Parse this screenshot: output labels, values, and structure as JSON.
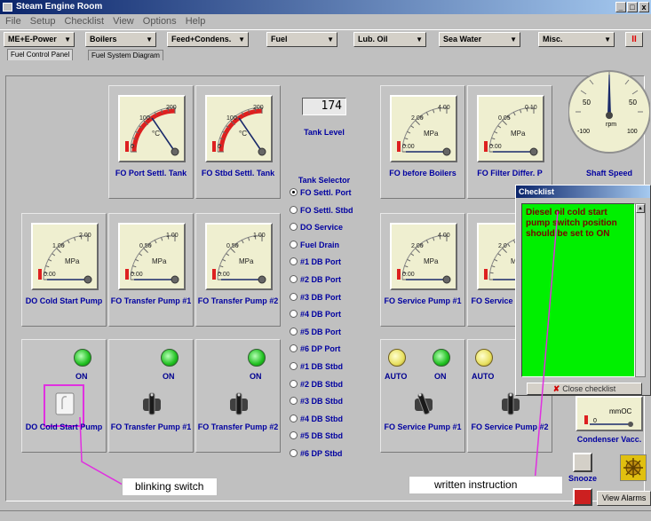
{
  "window": {
    "title": "Steam Engine Room",
    "controls": [
      "_",
      "□",
      "x"
    ]
  },
  "menu": [
    "File",
    "Setup",
    "Checklist",
    "View",
    "Options",
    "Help"
  ],
  "modebar": {
    "buttons": [
      "ME+E-Power",
      "Boilers",
      "Feed+Condens.",
      "Fuel",
      "Lub. Oil",
      "Sea Water",
      "Misc."
    ],
    "alarm_label": "II"
  },
  "tabs": [
    "Fuel Control Panel",
    "Fuel System Diagram"
  ],
  "gauges_row1": [
    {
      "label": "FO Port Settl. Tank",
      "unit": "°C",
      "scale": [
        "100",
        "200",
        "0"
      ],
      "value": 0.62,
      "color": "#dd2020"
    },
    {
      "label": "FO Stbd Settl. Tank",
      "unit": "°C",
      "scale": [
        "100",
        "200",
        "0"
      ],
      "value": 0.62,
      "color": "#dd2020"
    },
    {
      "label": "FO before Boilers",
      "unit": "MPa",
      "scale": [
        "2.00",
        "4.00",
        "0.00"
      ],
      "value": 0.0,
      "color": "#dd2020"
    },
    {
      "label": "FO Filter Differ. P",
      "unit": "MPa",
      "scale": [
        "0.05",
        "0.10",
        "0.00"
      ],
      "value": 0.0,
      "color": "#dd2020"
    }
  ],
  "tank_level": {
    "reading": "174",
    "label": "Tank Level"
  },
  "tank_selector": {
    "title": "Tank Selector",
    "options": [
      "FO Settl. Port",
      "FO Settl. Stbd",
      "DO Service",
      "Fuel Drain",
      "#1 DB Port",
      "#2 DB Port",
      "#3 DB Port",
      "#4 DB Port",
      "#5 DB Port",
      "#6 DP Port",
      "#1 DB Stbd",
      "#2 DB Stbd",
      "#3 DB Stbd",
      "#4 DB Stbd",
      "#5 DB Stbd",
      "#6 DP Stbd"
    ],
    "selected": "FO Settl. Port"
  },
  "gauges_row2": [
    {
      "label": "DO Cold Start Pump",
      "unit": "MPa",
      "scale": [
        "1.00",
        "2.00",
        "0.00"
      ],
      "value": 0.0,
      "color": "#dd2020"
    },
    {
      "label": "FO Transfer Pump #1",
      "unit": "MPa",
      "scale": [
        "0.50",
        "1.00",
        "0.00"
      ],
      "value": 0.0,
      "color": "#dd2020"
    },
    {
      "label": "FO Transfer Pump #2",
      "unit": "MPa",
      "scale": [
        "0.50",
        "1.00",
        "0.00"
      ],
      "value": 0.0,
      "color": "#dd2020"
    },
    {
      "label": "FO Service Pump #1",
      "unit": "MPa",
      "scale": [
        "2.00",
        "4.00",
        "0.00"
      ],
      "value": 0.0,
      "color": "#dd2020"
    },
    {
      "label": "FO Service Pump #2",
      "unit": "MPa",
      "scale": [
        "2.0",
        "",
        ""
      ],
      "value": 0.0,
      "color": "#dd2020"
    }
  ],
  "switches": [
    {
      "label": "DO Cold Start Pump",
      "on_label": "ON",
      "blinking": true
    },
    {
      "label": "FO Transfer Pump #1",
      "on_label": "ON",
      "blinking": false
    },
    {
      "label": "FO Transfer Pump #2",
      "on_label": "ON",
      "blinking": false
    },
    {
      "label": "FO Service Pump #1",
      "auto_label": "AUTO",
      "on_label": "ON",
      "blinking": false
    },
    {
      "label": "FO Service Pump #2",
      "auto_label": "AUTO",
      "on_label": "",
      "blinking": false
    }
  ],
  "shaft_speed": {
    "label": "Shaft Speed",
    "unit": "rpm",
    "scale": [
      "50",
      "50",
      "-100",
      "100"
    ]
  },
  "checklist": {
    "title": "Checklist",
    "text": "Diesel oil cold start pump switch position should be set to ON",
    "close_label": "Close checklist"
  },
  "condenser": {
    "label": "Condenser Vacc.",
    "unit": "mmOC",
    "scale": [
      "0"
    ]
  },
  "snooze_label": "Snooze",
  "view_alarms_label": "View Alarms",
  "annotations": {
    "left": "blinking switch",
    "right": "written instruction"
  },
  "colors": {
    "lamp_green": "#20c020",
    "lamp_yellow": "#e8e060",
    "checklist_bg": "#00f000",
    "highlight": "#e030e0",
    "label_blue": "#0000a0"
  }
}
